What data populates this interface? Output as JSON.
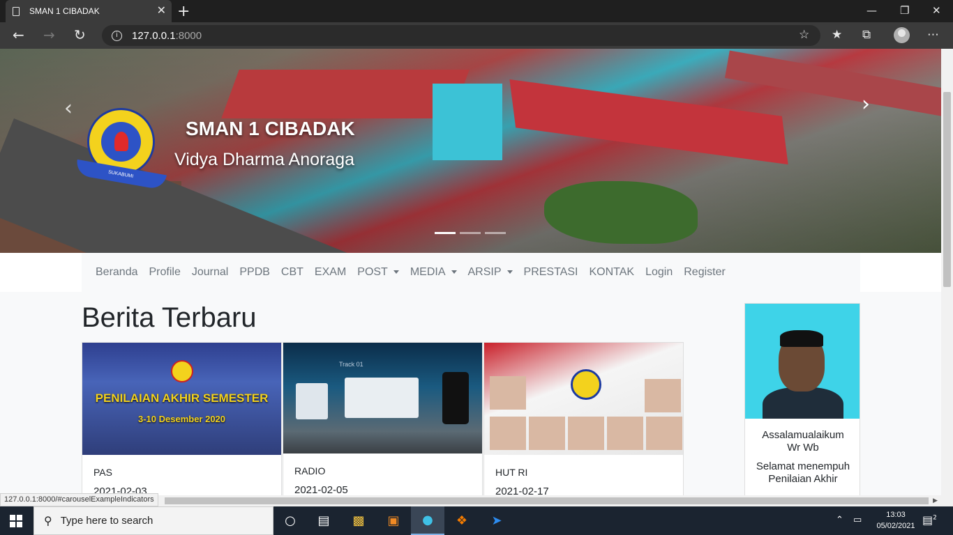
{
  "browser": {
    "tab_title": "SMAN 1 CIBADAK",
    "tab_close": "✕",
    "new_tab": "+",
    "url_host": "127.0.0.1",
    "url_port": ":8000",
    "status_url": "127.0.0.1:8000/#carouselExampleIndicators",
    "icons": [
      "back-icon",
      "forward-icon",
      "refresh-icon",
      "info-icon",
      "add-favorite-icon",
      "favorites-icon",
      "collections-icon",
      "profile-icon",
      "more-icon"
    ]
  },
  "hero": {
    "title": "SMAN 1 CIBADAK",
    "motto": "Vidya Dharma Anoraga",
    "logo_text": "SUKABUMI",
    "indicator_count": 3,
    "active_indicator": 0
  },
  "nav": {
    "items": [
      {
        "label": "Beranda"
      },
      {
        "label": "Profile"
      },
      {
        "label": "Journal"
      },
      {
        "label": "PPDB"
      },
      {
        "label": "CBT"
      },
      {
        "label": "EXAM"
      },
      {
        "label": "POST",
        "dropdown": true
      },
      {
        "label": "MEDIA",
        "dropdown": true
      },
      {
        "label": "ARSIP",
        "dropdown": true
      },
      {
        "label": "PRESTASI"
      },
      {
        "label": "KONTAK"
      },
      {
        "label": "Login"
      },
      {
        "label": "Register"
      }
    ]
  },
  "main": {
    "section_title": "Berita Terbaru",
    "cards": [
      {
        "title": "PAS",
        "date": "2021-02-03",
        "banner1": "PENILAIAN AKHIR SEMESTER",
        "banner2": "3-10 Desember 2020"
      },
      {
        "title": "RADIO",
        "date": "2021-02-05",
        "track": "Track 01"
      },
      {
        "title": "HUT RI",
        "date": "2021-02-17"
      }
    ]
  },
  "sidebar": {
    "greeting": "Assalamualaikum Wr Wb",
    "message": "Selamat menempuh Penilaian Akhir"
  },
  "taskbar": {
    "search_placeholder": "Type here to search",
    "time": "13:03",
    "date": "05/02/2021",
    "notification_count": "2"
  },
  "colors": {
    "nav_text": "#6c757d",
    "page_bg": "#f8f9fa",
    "taskbar_bg": "#1b2430",
    "browser_chrome": "#3b3b3b"
  }
}
